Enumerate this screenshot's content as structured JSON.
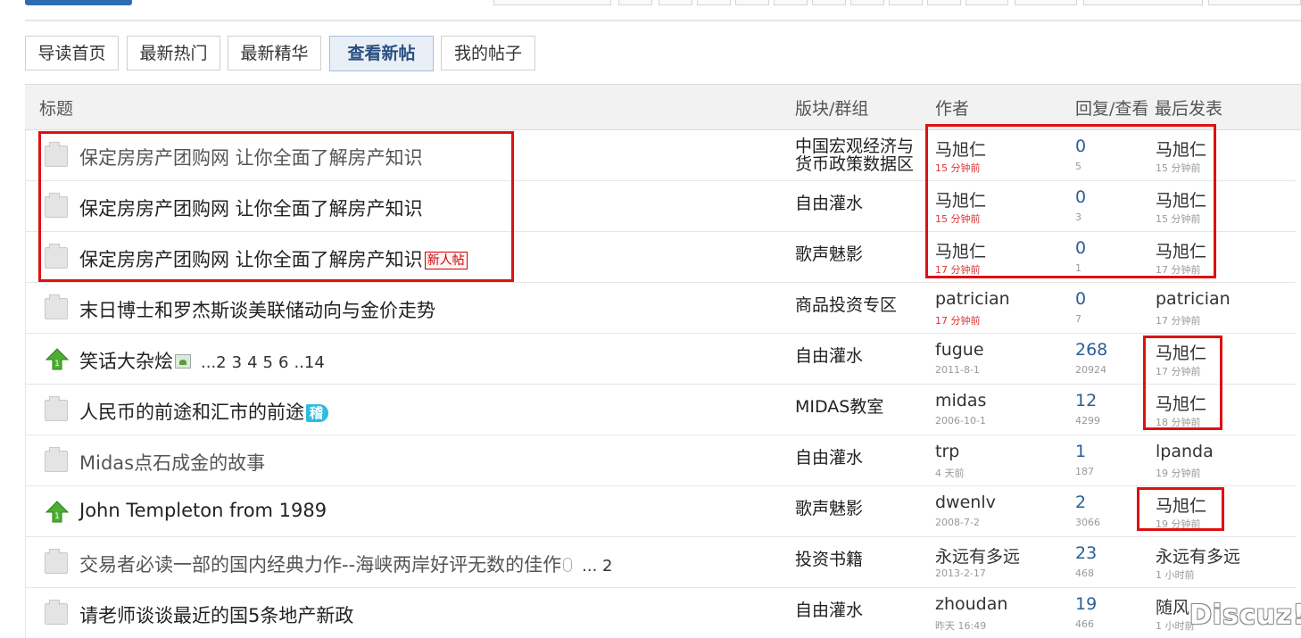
{
  "tabs": [
    {
      "label": "导读首页",
      "active": false
    },
    {
      "label": "最新热门",
      "active": false
    },
    {
      "label": "最新精华",
      "active": false
    },
    {
      "label": "查看新帖",
      "active": true
    },
    {
      "label": "我的帖子",
      "active": false
    }
  ],
  "columns": {
    "title": "标题",
    "forum": "版块/群组",
    "author": "作者",
    "replies_views": "回复/查看",
    "last_post": "最后发表"
  },
  "threads": [
    {
      "icon": "folder-icon",
      "title": "保定房房产团购网 让你全面了解房产知识",
      "visited": true,
      "badge": "",
      "pages": [],
      "forum": "中国宏观经济与货币政策数据区",
      "forum_line1": "中国宏观经济与",
      "forum_line2": "货币政策数据区",
      "author": "马旭仁",
      "author_time": "15 分钟前",
      "author_time_new": true,
      "replies": "0",
      "views": "5",
      "last_author": "马旭仁",
      "last_time": "15 分钟前"
    },
    {
      "icon": "folder-icon",
      "title": "保定房房产团购网 让你全面了解房产知识",
      "visited": false,
      "badge": "",
      "pages": [],
      "forum_line1": "自由灌水",
      "forum_line2": "",
      "author": "马旭仁",
      "author_time": "15 分钟前",
      "author_time_new": true,
      "replies": "0",
      "views": "3",
      "last_author": "马旭仁",
      "last_time": "15 分钟前"
    },
    {
      "icon": "folder-icon",
      "title": "保定房房产团购网 让你全面了解房产知识",
      "visited": false,
      "badge": "新人帖",
      "pages": [],
      "forum_line1": "歌声魅影",
      "forum_line2": "",
      "author": "马旭仁",
      "author_time": "17 分钟前",
      "author_time_new": true,
      "replies": "0",
      "views": "1",
      "last_author": "马旭仁",
      "last_time": "17 分钟前"
    },
    {
      "icon": "folder-icon",
      "title": "末日博士和罗杰斯谈美联储动向与金价走势",
      "visited": false,
      "badge": "",
      "pages": [],
      "forum_line1": "商品投资专区",
      "forum_line2": "",
      "author": "patrician",
      "author_time": "17 分钟前",
      "author_time_new": true,
      "replies": "0",
      "views": "7",
      "last_author": "patrician",
      "last_time": "17 分钟前"
    },
    {
      "icon": "up-arrow-icon",
      "title": "笑话大杂烩",
      "visited": false,
      "badge": "",
      "attach": "image",
      "pages": [
        "...2",
        "3",
        "4",
        "5",
        "6",
        "..14"
      ],
      "forum_line1": "自由灌水",
      "forum_line2": "",
      "author": "fugue",
      "author_time": "2011-8-1",
      "author_time_new": false,
      "replies": "268",
      "views": "20924",
      "last_author": "马旭仁",
      "last_time": "17 分钟前"
    },
    {
      "icon": "folder-icon",
      "title": "人民币的前途和汇市的前途",
      "visited": false,
      "badge": "稽",
      "pages": [],
      "forum_line1": "MIDAS教室",
      "forum_line2": "",
      "author": "midas",
      "author_time": "2006-10-1",
      "author_time_new": false,
      "replies": "12",
      "views": "4299",
      "last_author": "马旭仁",
      "last_time": "18 分钟前"
    },
    {
      "icon": "folder-icon",
      "title": "Midas点石成金的故事",
      "visited": true,
      "badge": "",
      "pages": [],
      "forum_line1": "自由灌水",
      "forum_line2": "",
      "author": "trp",
      "author_time": "4 天前",
      "author_time_new": false,
      "replies": "1",
      "views": "187",
      "last_author": "lpanda",
      "last_time": "19 分钟前"
    },
    {
      "icon": "up-arrow-icon",
      "title": "John Templeton from 1989",
      "visited": false,
      "badge": "",
      "pages": [],
      "forum_line1": "歌声魅影",
      "forum_line2": "",
      "author": "dwenlv",
      "author_time": "2008-7-2",
      "author_time_new": false,
      "replies": "2",
      "views": "3066",
      "last_author": "马旭仁",
      "last_time": "19 分钟前"
    },
    {
      "icon": "folder-icon",
      "title": "交易者必读一部的国内经典力作--海峡两岸好评无数的佳作",
      "visited": true,
      "badge": "",
      "attach": "clip",
      "pages": [
        "... 2"
      ],
      "forum_line1": "投资书籍",
      "forum_line2": "",
      "author": "永远有多远",
      "author_time": "2013-2-17",
      "author_time_new": false,
      "replies": "23",
      "views": "468",
      "last_author": "永远有多远",
      "last_time": "1 小时前"
    },
    {
      "icon": "folder-icon",
      "title": "请老师谈谈最近的国5条地产新政",
      "visited": false,
      "badge": "",
      "pages": [],
      "forum_line1": "自由灌水",
      "forum_line2": "",
      "author": "zhoudan",
      "author_time": "昨天 16:49",
      "author_time_new": false,
      "replies": "19",
      "views": "466",
      "last_author": "随风",
      "last_time": "1 小时前"
    }
  ],
  "watermark": "Discuz!",
  "colors": {
    "accent": "#2c5e97",
    "highlight": "#dd1111",
    "new_time": "#dd3333"
  }
}
